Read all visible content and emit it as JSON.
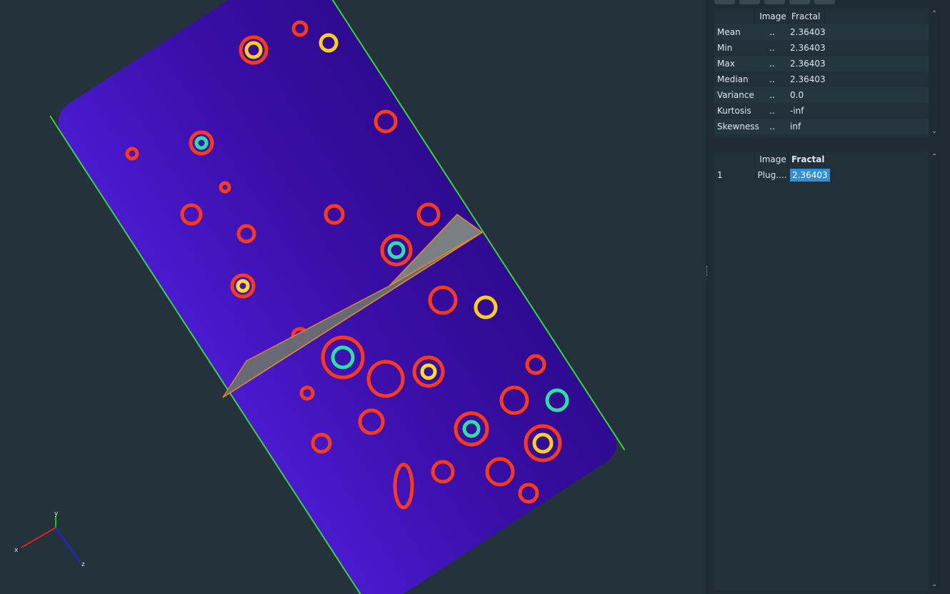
{
  "stats_table": {
    "headers": [
      "",
      "Image",
      "Fractal"
    ],
    "rows": [
      {
        "label": "Mean",
        "image": "..",
        "fractal": "2.36403"
      },
      {
        "label": "Min",
        "image": "..",
        "fractal": "2.36403"
      },
      {
        "label": "Max",
        "image": "..",
        "fractal": "2.36403"
      },
      {
        "label": "Median",
        "image": "..",
        "fractal": "2.36403"
      },
      {
        "label": "Variance",
        "image": "..",
        "fractal": "0.0"
      },
      {
        "label": "Kurtosis",
        "image": "..",
        "fractal": "-inf"
      },
      {
        "label": "Skewness",
        "image": "..",
        "fractal": "inf"
      }
    ]
  },
  "results_table": {
    "headers": [
      "",
      "Image",
      "Fractal"
    ],
    "rows": [
      {
        "index": "1",
        "image": "Plug....",
        "fractal": "2.36403"
      }
    ]
  },
  "axes": {
    "x": "x",
    "y": "y",
    "z": "z"
  },
  "colors": {
    "cylinder": "#3d0fb0",
    "highlight": "#2f8fd9",
    "axis_x": "#e02020",
    "axis_y": "#20c020",
    "axis_z": "#2020e0"
  },
  "icons": {
    "scroll_up": "chevron-up-icon",
    "scroll_down": "chevron-down-icon"
  }
}
